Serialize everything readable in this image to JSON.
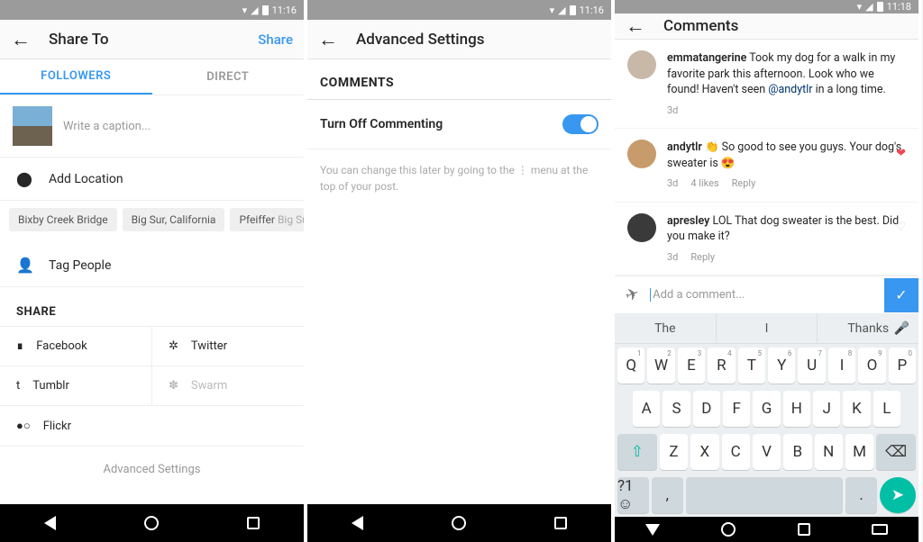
{
  "p1": {
    "status_time": "11:16",
    "title": "Share To",
    "action": "Share",
    "tabs": {
      "followers": "FOLLOWERS",
      "direct": "DIRECT"
    },
    "caption_placeholder": "Write a caption...",
    "add_location": "Add Location",
    "chips": [
      {
        "text": "Bixby Creek Bridge"
      },
      {
        "text": "Big Sur, California"
      },
      {
        "text": "Pfeiffer",
        "dim": "Big Sur State P"
      }
    ],
    "tag_people": "Tag People",
    "share_label": "SHARE",
    "share": {
      "facebook": "Facebook",
      "twitter": "Twitter",
      "tumblr": "Tumblr",
      "swarm": "Swarm",
      "flickr": "Flickr"
    },
    "adv": "Advanced Settings"
  },
  "p2": {
    "status_time": "11:16",
    "title": "Advanced Settings",
    "section": "COMMENTS",
    "toggle_label": "Turn Off Commenting",
    "help": "You can change this later by going to the ⋮ menu at the top of your post."
  },
  "p3": {
    "status_time": "11:18",
    "title": "Comments",
    "comments": [
      {
        "user": "emmatangerine",
        "text": " Took my dog for a walk in my favorite park this afternoon. Look who we found! Haven't seen ",
        "mention": "@andytlr",
        "text2": " in a long time.",
        "time": "3d"
      },
      {
        "user": "andytlr",
        "text": " 👏 So good to see you guys. Your dog's sweater is 😍",
        "time": "3d",
        "likes": "4 likes",
        "reply": "Reply"
      },
      {
        "user": "apresley",
        "text": " LOL That dog sweater is the best. Did you make it?",
        "time": "3d",
        "reply": "Reply"
      }
    ],
    "add_placeholder": "Add a comment...",
    "sugg": [
      "The",
      "I",
      "Thanks"
    ],
    "rows": [
      [
        [
          "Q",
          "1"
        ],
        [
          "W",
          "2"
        ],
        [
          "E",
          "3"
        ],
        [
          "R",
          "4"
        ],
        [
          "T",
          "5"
        ],
        [
          "Y",
          "6"
        ],
        [
          "U",
          "7"
        ],
        [
          "I",
          "8"
        ],
        [
          "O",
          "9"
        ],
        [
          "P",
          "0"
        ]
      ],
      [
        [
          "A",
          ""
        ],
        [
          "S",
          ""
        ],
        [
          "D",
          ""
        ],
        [
          "F",
          ""
        ],
        [
          "G",
          ""
        ],
        [
          "H",
          ""
        ],
        [
          "J",
          ""
        ],
        [
          "K",
          ""
        ],
        [
          "L",
          ""
        ]
      ],
      [
        [
          "Z",
          ""
        ],
        [
          "X",
          ""
        ],
        [
          "C",
          ""
        ],
        [
          "V",
          ""
        ],
        [
          "B",
          ""
        ],
        [
          "N",
          ""
        ],
        [
          "M",
          ""
        ]
      ]
    ],
    "sym": "?1☺",
    "comma": ",",
    "period": "."
  }
}
